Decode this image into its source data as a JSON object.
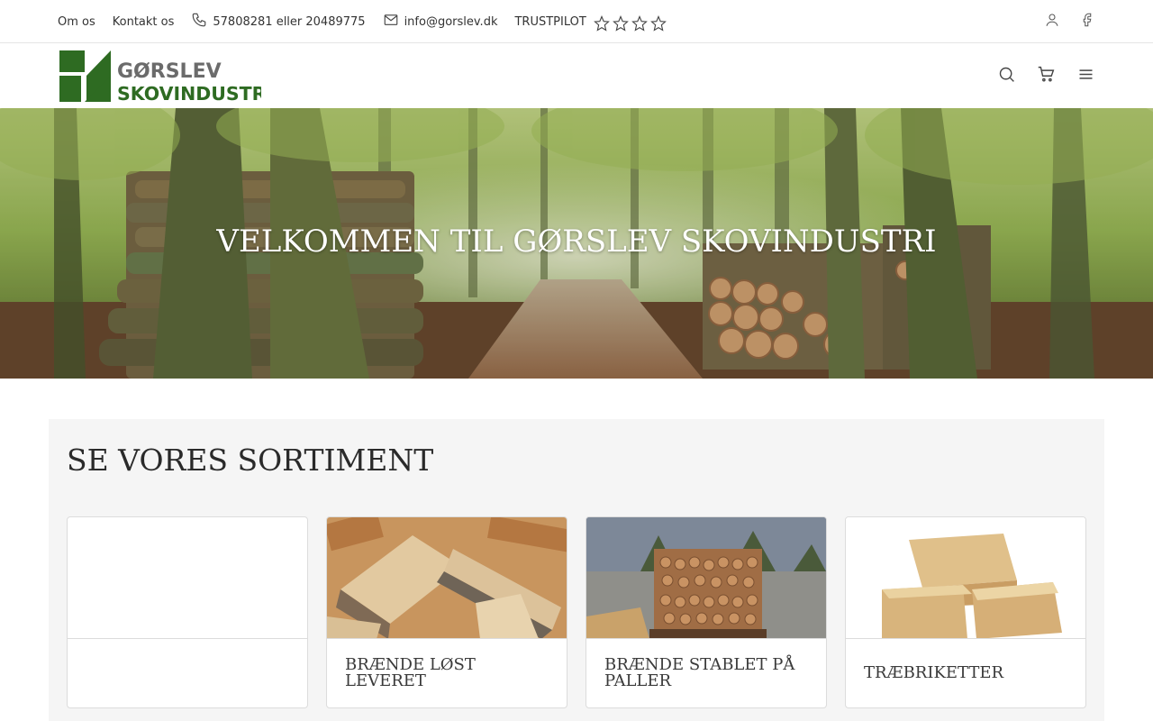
{
  "topbar": {
    "links": [
      {
        "label": "Om os"
      },
      {
        "label": "Kontakt os"
      }
    ],
    "phone": "57808281 eller 20489775",
    "email": "info@gorslev.dk",
    "trustpilot_label": "TRUSTPILOT",
    "trustpilot_stars": 4,
    "icons": [
      "phone-icon",
      "mail-icon",
      "star-icon",
      "user-icon",
      "facebook-icon"
    ]
  },
  "header": {
    "logo_line1": "GØRSLEV",
    "logo_line2": "SKOVINDUSTRI",
    "icons": [
      "search-icon",
      "cart-icon",
      "menu-icon"
    ]
  },
  "hero": {
    "title": "VELKOMMEN TIL GØRSLEV SKOVINDUSTRI"
  },
  "assortment": {
    "heading": "SE VORES SORTIMENT",
    "cards": [
      {
        "title": ""
      },
      {
        "title": "BRÆNDE LØST LEVERET"
      },
      {
        "title": "BRÆNDE STABLET PÅ PALLER"
      },
      {
        "title": "TRÆBRIKETTER"
      }
    ]
  },
  "colors": {
    "brand_green": "#2e6b22",
    "logo_gray": "#6b6b6b",
    "trustpilot_green": "#00b67a"
  }
}
